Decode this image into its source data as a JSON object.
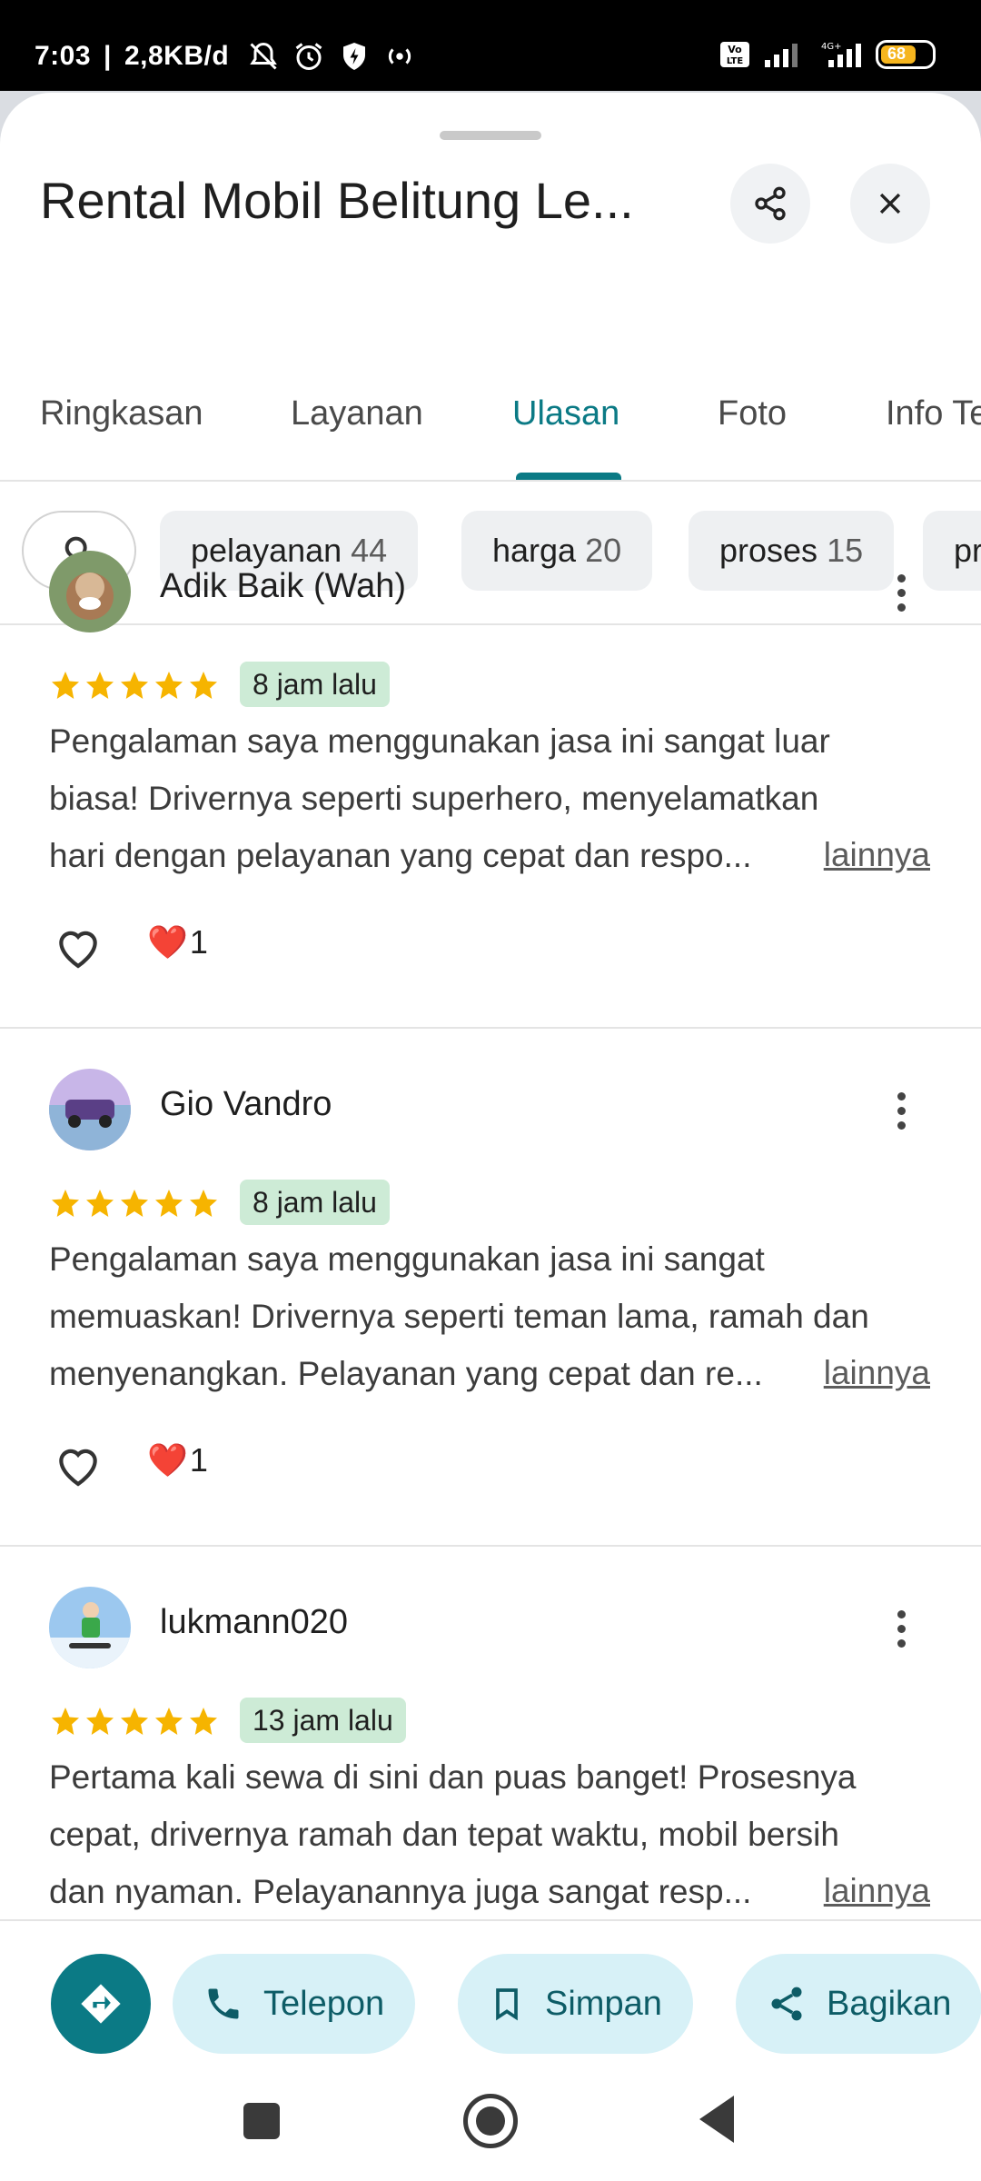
{
  "status_bar": {
    "time": "7:03",
    "net_speed": "2,8KB/d",
    "network_type": "4G+",
    "volte": "Vo LTE",
    "battery": "68"
  },
  "place": {
    "title": "Rental Mobil Belitung Le..."
  },
  "tabs": [
    {
      "label": "Ringkasan",
      "active": false
    },
    {
      "label": "Layanan",
      "active": false
    },
    {
      "label": "Ulasan",
      "active": true
    },
    {
      "label": "Foto",
      "active": false
    },
    {
      "label": "Info Te",
      "active": false
    }
  ],
  "chips": [
    {
      "label": "pelayanan",
      "count": "44"
    },
    {
      "label": "harga",
      "count": "20"
    },
    {
      "label": "proses",
      "count": "15"
    },
    {
      "label": "pr",
      "count": ""
    }
  ],
  "reviews": [
    {
      "author": "Adik Baik (Wah)",
      "rating": 5,
      "time": "8 jam lalu",
      "text_lines": [
        "Pengalaman saya menggunakan jasa ini sangat luar",
        "biasa! Drivernya seperti superhero, menyelamatkan",
        "hari dengan pelayanan yang cepat dan respo..."
      ],
      "more_label": "lainnya",
      "reaction_emoji": "❤️",
      "reaction_count": "1"
    },
    {
      "author": "Gio Vandro",
      "rating": 5,
      "time": "8 jam lalu",
      "text_lines": [
        "Pengalaman saya menggunakan jasa ini sangat",
        "memuaskan! Drivernya seperti teman lama, ramah dan",
        "menyenangkan. Pelayanan yang cepat dan re..."
      ],
      "more_label": "lainnya",
      "reaction_emoji": "❤️",
      "reaction_count": "1"
    },
    {
      "author": "lukmann020",
      "rating": 5,
      "time": "13 jam lalu",
      "text_lines": [
        "Pertama kali sewa di sini dan puas banget! Prosesnya",
        "cepat, drivernya ramah dan tepat waktu, mobil bersih",
        "dan nyaman. Pelayanannya juga sangat resp..."
      ],
      "more_label": "lainnya"
    }
  ],
  "actions": {
    "call_label": "Telepon",
    "save_label": "Simpan",
    "share_label": "Bagikan"
  },
  "colors": {
    "accent": "#0b7a85",
    "pill_bg": "#d7f1f7",
    "badge_bg": "#cdebd6",
    "star": "#f6b400"
  }
}
